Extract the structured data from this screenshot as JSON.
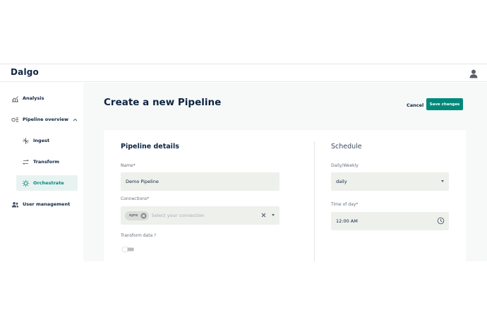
{
  "app": {
    "logo": "Dalgo"
  },
  "sidebar": {
    "items": [
      {
        "label": "Analysis",
        "icon": "chart-icon"
      },
      {
        "label": "Pipeline overview",
        "icon": "pipeline-icon"
      },
      {
        "label": "Ingest",
        "icon": "ingest-icon"
      },
      {
        "label": "Transform",
        "icon": "transform-icon"
      },
      {
        "label": "Orchestrate",
        "icon": "orchestrate-icon"
      },
      {
        "label": "User management",
        "icon": "users-icon"
      }
    ],
    "active": "Orchestrate"
  },
  "header": {
    "title": "Create a new Pipeline",
    "cancel_label": "Cancel",
    "save_label": "Save changes"
  },
  "pipeline_details": {
    "title": "Pipeline details",
    "name_label": "Name",
    "name_value": "Demo Pipeline",
    "connections_label": "Connections",
    "connection_chip": "sync",
    "connections_placeholder": "Select your connection",
    "transform_label": "Transform data ?",
    "transform_enabled": false
  },
  "schedule": {
    "title": "Schedule",
    "frequency_label": "Daily/Weekly",
    "frequency_value": "daily",
    "time_label": "Time of day",
    "time_value": "12:00 AM"
  },
  "colors": {
    "accent": "#00897b",
    "navy": "#0f2440",
    "field_bg": "#eef0eb"
  }
}
